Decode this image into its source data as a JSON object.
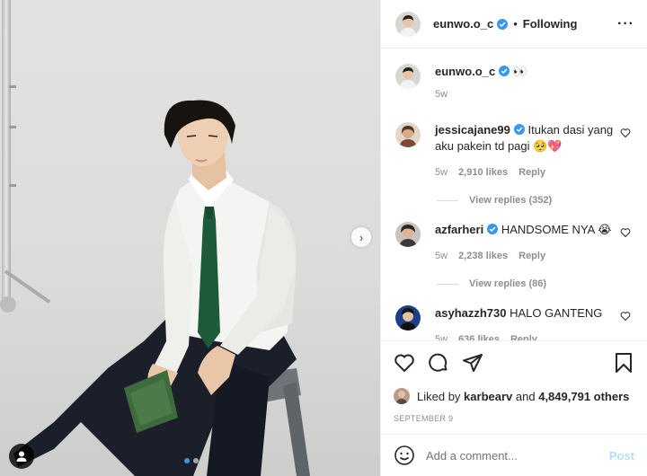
{
  "post": {
    "username": "eunwo.o_c",
    "follow_status": "Following",
    "caption_text": "👀",
    "caption_age": "5w",
    "liked_by_prefix": "Liked by",
    "liked_by_user": "karbearv",
    "liked_by_and": "and",
    "liked_by_count": "4,849,791 others",
    "date": "SEPTEMBER 9",
    "carousel_position": 1,
    "carousel_count": 2
  },
  "comments": [
    {
      "username": "jessicajane99",
      "text": "Itukan dasi yang aku pakein td pagi 🥺💖",
      "age": "5w",
      "likes": "2,910 likes",
      "reply": "Reply",
      "view_replies": "View replies (352)"
    },
    {
      "username": "azfarheri",
      "text": "HANDSOME NYA 😭",
      "age": "5w",
      "likes": "2,238 likes",
      "reply": "Reply",
      "view_replies": "View replies (86)"
    },
    {
      "username": "asyhazzh730",
      "text": "HALO GANTENG",
      "age": "5w",
      "likes": "636 likes",
      "reply": "Reply"
    }
  ],
  "add_comment": {
    "placeholder": "Add a comment...",
    "post_label": "Post"
  },
  "colors": {
    "accent": "#3897f0",
    "verified": "#3897f0",
    "post_disabled": "#b2dffc",
    "muted": "#8e8e8e"
  },
  "icons": [
    "more-icon",
    "verified-icon",
    "heart-icon",
    "comment-icon",
    "share-icon",
    "bookmark-icon",
    "emoji-icon",
    "next-arrow-icon",
    "tag-user-icon"
  ]
}
